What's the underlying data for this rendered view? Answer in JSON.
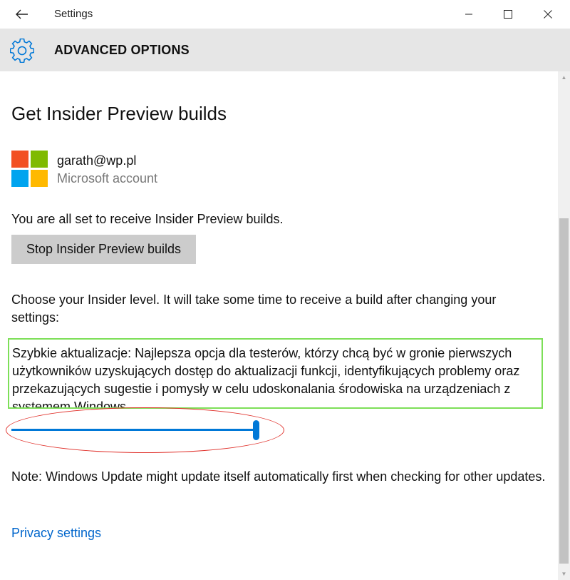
{
  "window": {
    "title": "Settings",
    "icons": {
      "back": "back-arrow-icon",
      "minimize": "minimize-icon",
      "maximize": "maximize-icon",
      "close": "close-icon"
    }
  },
  "header": {
    "icon": "gear-icon",
    "title": "ADVANCED OPTIONS"
  },
  "main": {
    "heading": "Get Insider Preview builds",
    "account": {
      "email": "garath@wp.pl",
      "type": "Microsoft account",
      "logo_colors": [
        "#f25022",
        "#7fba00",
        "#00a4ef",
        "#ffb900"
      ]
    },
    "status_text": "You are all set to receive Insider Preview builds.",
    "stop_button_label": "Stop Insider Preview builds",
    "choose_level_text": "Choose your Insider level. It will take some time to receive a build after changing your settings:",
    "level_description": "Szybkie aktualizacje: Najlepsza opcja dla testerów, którzy chcą być w gronie pierwszych użytkowników uzyskujących dostęp do aktualizacji funkcji, identyfikujących problemy oraz przekazujących sugestie i pomysły w celu udoskonalania środowiska na urządzeniach z systemem Windows.",
    "level_slider": {
      "value": 1.0
    },
    "note_text": "Note: Windows Update might update itself automatically first when checking for other updates.",
    "privacy_link": "Privacy settings"
  },
  "colors": {
    "accent": "#0078d7",
    "link": "#0066cc",
    "highlight_box": "#7ddf58",
    "annotation_ellipse": "#e0302a",
    "header_bg": "#e6e6e6",
    "button_bg": "#cccccc"
  }
}
